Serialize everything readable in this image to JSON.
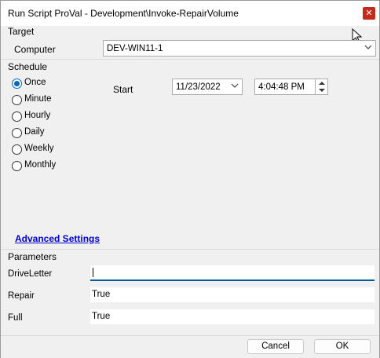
{
  "window": {
    "title": "Run Script ProVal - Development\\Invoke-RepairVolume",
    "close_icon": "close-icon"
  },
  "target": {
    "section_label": "Target",
    "computer_label": "Computer",
    "computer_value": "DEV-WIN11-1"
  },
  "schedule": {
    "section_label": "Schedule",
    "options": [
      {
        "label": "Once",
        "checked": true
      },
      {
        "label": "Minute",
        "checked": false
      },
      {
        "label": "Hourly",
        "checked": false
      },
      {
        "label": "Daily",
        "checked": false
      },
      {
        "label": "Weekly",
        "checked": false
      },
      {
        "label": "Monthly",
        "checked": false
      }
    ],
    "start_label": "Start",
    "start_date": "11/23/2022",
    "start_time": "4:04:48 PM"
  },
  "advanced_settings_link": "Advanced Settings",
  "parameters": {
    "section_label": "Parameters",
    "items": [
      {
        "label": "DriveLetter",
        "value": ""
      },
      {
        "label": "Repair",
        "value": "True"
      },
      {
        "label": "Full",
        "value": "True"
      }
    ]
  },
  "footer": {
    "cancel_label": "Cancel",
    "ok_label": "OK"
  },
  "colors": {
    "accent": "#0067c0",
    "link": "#0000cc",
    "close": "#c42b1c"
  }
}
